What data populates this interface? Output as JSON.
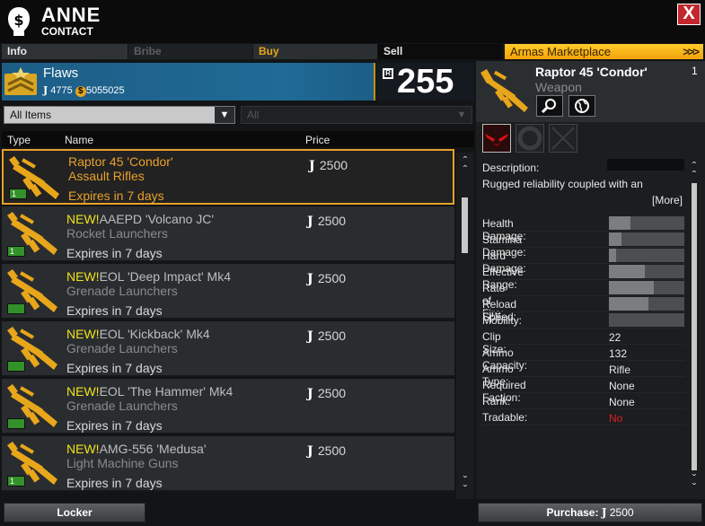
{
  "header": {
    "name": "ANNE",
    "subtitle": "CONTACT",
    "close_label": "X"
  },
  "tabs": [
    {
      "label": "Info"
    },
    {
      "label": "Bribe"
    },
    {
      "label": "Buy"
    },
    {
      "label": "Sell"
    },
    {
      "label": "Armas Marketplace",
      "arrows": ">>>"
    }
  ],
  "player": {
    "name": "Flaws",
    "joker_tickets": "4775",
    "money": "5055025",
    "score": "255"
  },
  "filters": {
    "category": "All Items",
    "sub": "All"
  },
  "list_headers": {
    "type": "Type",
    "name": "Name",
    "price": "Price"
  },
  "items": [
    {
      "new": "",
      "name": "Raptor 45 'Condor'",
      "category": "Assault Rifles",
      "expires": "Expires in 7 days",
      "price": "2500",
      "badge": "1",
      "selected": true
    },
    {
      "new": "NEW!",
      "name": "AAEPD 'Volcano JC'",
      "category": "Rocket Launchers",
      "expires": "Expires in 7 days",
      "price": "2500",
      "badge": "1",
      "selected": false
    },
    {
      "new": "NEW!",
      "name": "EOL 'Deep Impact' Mk4",
      "category": "Grenade Launchers",
      "expires": "Expires in 7 days",
      "price": "2500",
      "badge": "",
      "selected": false
    },
    {
      "new": "NEW!",
      "name": "EOL 'Kickback' Mk4",
      "category": "Grenade Launchers",
      "expires": "Expires in 7 days",
      "price": "2500",
      "badge": "",
      "selected": false
    },
    {
      "new": "NEW!",
      "name": "EOL 'The Hammer' Mk4",
      "category": "Grenade Launchers",
      "expires": "Expires in 7 days",
      "price": "2500",
      "badge": "",
      "selected": false
    },
    {
      "new": "NEW!",
      "name": "AMG-556 'Medusa'",
      "category": "Light Machine Guns",
      "expires": "Expires in 7 days",
      "price": "2500",
      "badge": "1",
      "selected": false
    }
  ],
  "buttons": {
    "locker": "Locker",
    "purchase": "Purchase:",
    "purchase_price": "2500"
  },
  "detail": {
    "name": "Raptor 45 'Condor'",
    "type": "Weapon",
    "count": "1",
    "description_label": "Description:",
    "description": "Rugged reliability coupled with an",
    "more": "[More]",
    "bar_stats": [
      {
        "label": "Health Damage:",
        "level": 0.28
      },
      {
        "label": "Stamina Damage:",
        "level": 0.17
      },
      {
        "label": "Hard Damage:",
        "level": 0.1
      },
      {
        "label": "Effective Range:",
        "level": 0.48
      },
      {
        "label": "Rate of Fire:",
        "level": 0.6
      },
      {
        "label": "Reload Speed:",
        "level": 0.52
      },
      {
        "label": "Mobility:",
        "level": 0.0
      }
    ],
    "text_stats": [
      {
        "label": "Clip Size:",
        "value": "22"
      },
      {
        "label": "Ammo Capacity:",
        "value": "132"
      },
      {
        "label": "Ammo Type:",
        "value": "Rifle"
      },
      {
        "label": "Required Faction:",
        "value": "None"
      },
      {
        "label": "Rank:",
        "value": "None"
      },
      {
        "label": "Tradable:",
        "value": "No",
        "color": "#e02020"
      }
    ]
  },
  "colors": {
    "accent": "#e8a02b",
    "new_tag": "#f2e21a",
    "player_bar": "#1f6b96",
    "close": "#c1272d"
  }
}
